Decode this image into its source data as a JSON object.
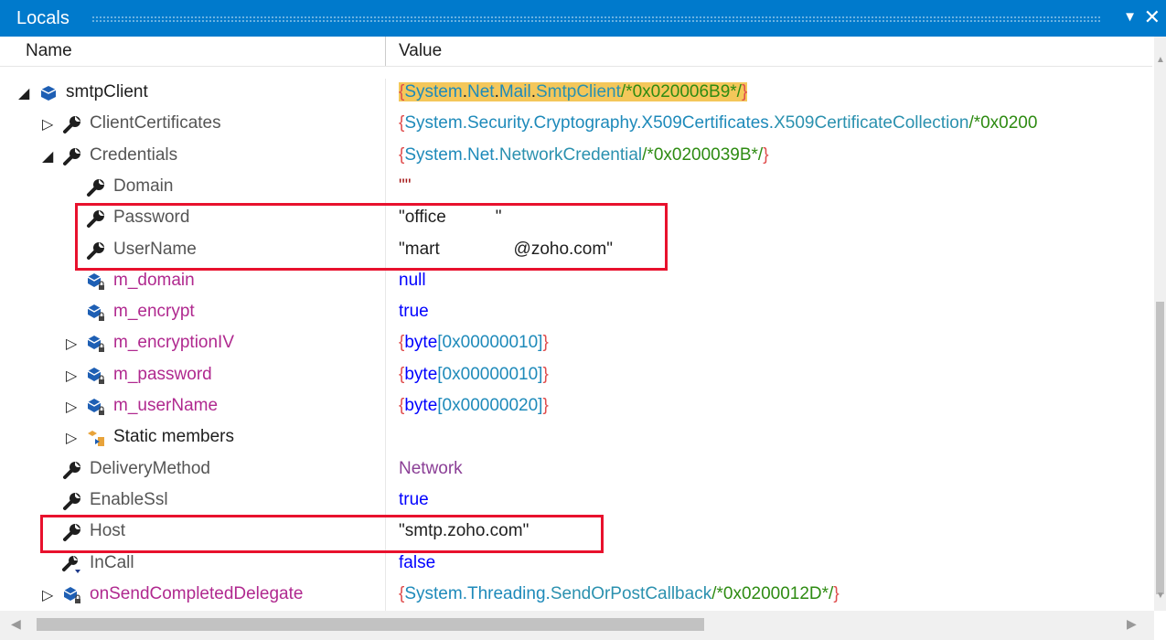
{
  "window": {
    "title": "Locals"
  },
  "columns": {
    "name": "Name",
    "value": "Value"
  },
  "rows": [
    {
      "depth": 0,
      "expander": "◢",
      "kind": "local",
      "name": "smtpClient",
      "value": [
        [
          "{",
          "#e04c4c"
        ],
        [
          "System",
          "#1e8aba"
        ],
        [
          ".",
          "#1e1e1e"
        ],
        [
          "Net",
          "#1e8aba"
        ],
        [
          ".",
          "#1e1e1e"
        ],
        [
          "Mail",
          "#1e8aba"
        ],
        [
          ".",
          "#1e1e1e"
        ],
        [
          "SmtpClient",
          "#2b91af"
        ],
        [
          "/*0x020006B9*/",
          "#2e8b12"
        ],
        [
          "}",
          "#e04c4c"
        ]
      ],
      "highlight": true
    },
    {
      "depth": 1,
      "expander": "▷",
      "kind": "prop",
      "name": "ClientCertificates",
      "value": [
        [
          "{",
          "#e04c4c"
        ],
        [
          "System.Security.Cryptography.X509Certificates.",
          "#1e8aba"
        ],
        [
          "X509CertificateCollection",
          "#2b91af"
        ],
        [
          "/*0x0200",
          "#2e8b12"
        ]
      ]
    },
    {
      "depth": 1,
      "expander": "◢",
      "kind": "prop",
      "name": "Credentials",
      "value": [
        [
          "{",
          "#e04c4c"
        ],
        [
          "System.Net.",
          "#1e8aba"
        ],
        [
          "NetworkCredential",
          "#2b91af"
        ],
        [
          "/*0x0200039B*/",
          "#2e8b12"
        ],
        [
          "}",
          "#e04c4c"
        ]
      ]
    },
    {
      "depth": 2,
      "expander": "",
      "kind": "prop",
      "name": "Domain",
      "value": [
        [
          "\"\"",
          "#a31515"
        ]
      ]
    },
    {
      "depth": 2,
      "expander": "",
      "kind": "prop",
      "name": "Password",
      "value": [
        [
          "\"office",
          "#1e1e1e"
        ],
        [
          "████",
          "#ffffff"
        ],
        [
          "\"",
          "#1e1e1e"
        ]
      ]
    },
    {
      "depth": 2,
      "expander": "",
      "kind": "prop",
      "name": "UserName",
      "value": [
        [
          "\"mart",
          "#1e1e1e"
        ],
        [
          "██████",
          "#ffffff"
        ],
        [
          "@zoho.com\"",
          "#1e1e1e"
        ]
      ]
    },
    {
      "depth": 2,
      "expander": "",
      "kind": "field",
      "name": "m_domain",
      "value": [
        [
          "null",
          "#0000ff"
        ]
      ]
    },
    {
      "depth": 2,
      "expander": "",
      "kind": "field",
      "name": "m_encrypt",
      "value": [
        [
          "true",
          "#0000ff"
        ]
      ]
    },
    {
      "depth": 2,
      "expander": "▷",
      "kind": "field",
      "name": "m_encryptionIV",
      "value": [
        [
          "{",
          "#e04c4c"
        ],
        [
          "byte",
          "#0000ff"
        ],
        [
          "[0x00000010]",
          "#1e8aba"
        ],
        [
          "}",
          "#e04c4c"
        ]
      ]
    },
    {
      "depth": 2,
      "expander": "▷",
      "kind": "field",
      "name": "m_password",
      "value": [
        [
          "{",
          "#e04c4c"
        ],
        [
          "byte",
          "#0000ff"
        ],
        [
          "[0x00000010]",
          "#1e8aba"
        ],
        [
          "}",
          "#e04c4c"
        ]
      ]
    },
    {
      "depth": 2,
      "expander": "▷",
      "kind": "field",
      "name": "m_userName",
      "value": [
        [
          "{",
          "#e04c4c"
        ],
        [
          "byte",
          "#0000ff"
        ],
        [
          "[0x00000020]",
          "#1e8aba"
        ],
        [
          "}",
          "#e04c4c"
        ]
      ]
    },
    {
      "depth": 2,
      "expander": "▷",
      "kind": "static",
      "name": "Static members",
      "value": []
    },
    {
      "depth": 1,
      "expander": "",
      "kind": "prop",
      "name": "DeliveryMethod",
      "value": [
        [
          "Network",
          "#8b3f96"
        ]
      ]
    },
    {
      "depth": 1,
      "expander": "",
      "kind": "prop",
      "name": "EnableSsl",
      "value": [
        [
          "true",
          "#0000ff"
        ]
      ]
    },
    {
      "depth": 1,
      "expander": "",
      "kind": "prop",
      "name": "Host",
      "value": [
        [
          "\"smtp.zoho.com\"",
          "#1e1e1e"
        ]
      ]
    },
    {
      "depth": 1,
      "expander": "",
      "kind": "propalt",
      "name": "InCall",
      "value": [
        [
          "false",
          "#0000ff"
        ]
      ]
    },
    {
      "depth": 1,
      "expander": "▷",
      "kind": "field",
      "name": "onSendCompletedDelegate",
      "value": [
        [
          "{",
          "#e04c4c"
        ],
        [
          "System.Threading.",
          "#1e8aba"
        ],
        [
          "SendOrPostCallback",
          "#2b91af"
        ],
        [
          "/*0x0200012D*/",
          "#2e8b12"
        ],
        [
          "}",
          "#e04c4c"
        ]
      ]
    }
  ],
  "colors": {
    "accent": "#007acc",
    "highlight_box": "#e8112d",
    "property_name": "#555555",
    "field_name": "#b0298f"
  },
  "icons": {
    "local": "local-variable-icon",
    "prop": "wrench-property-icon",
    "field": "private-field-icon",
    "static": "static-members-icon",
    "propalt": "property-with-marker-icon"
  }
}
